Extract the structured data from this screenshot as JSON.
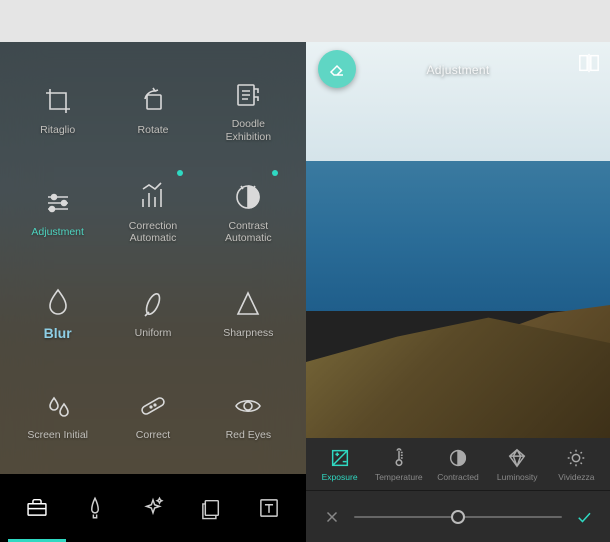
{
  "app": {
    "title": "Adjustment"
  },
  "colors": {
    "accent": "#2fd9c2"
  },
  "toolGrid": [
    {
      "key": "crop",
      "label": "Ritaglio"
    },
    {
      "key": "rotate",
      "label": "Rotate"
    },
    {
      "key": "doodle",
      "label": "Doodle Exhibition"
    },
    {
      "key": "adjustment",
      "label": "Adjustment",
      "active": true
    },
    {
      "key": "autocorrect",
      "label": "Correction Automatic",
      "badge": true
    },
    {
      "key": "autocontrast",
      "label": "Contrast Automatic",
      "badge": true
    },
    {
      "key": "blur",
      "label": "Blur",
      "highlight": true
    },
    {
      "key": "uniform",
      "label": "Uniform"
    },
    {
      "key": "sharpness",
      "label": "Sharpness"
    },
    {
      "key": "screen",
      "label": "Screen Initial"
    },
    {
      "key": "correct",
      "label": "Correct"
    },
    {
      "key": "redeyes",
      "label": "Red Eyes"
    }
  ],
  "bottomNav": [
    {
      "key": "toolbox",
      "active": true
    },
    {
      "key": "brush"
    },
    {
      "key": "magic"
    },
    {
      "key": "layers"
    },
    {
      "key": "text"
    }
  ],
  "adjustStrip": [
    {
      "key": "exposure",
      "label": "Exposure",
      "active": true
    },
    {
      "key": "temperature",
      "label": "Temperature"
    },
    {
      "key": "contrast",
      "label": "Contracted"
    },
    {
      "key": "luminosity",
      "label": "Luminosity"
    },
    {
      "key": "vividness",
      "label": "Vividezza"
    }
  ],
  "slider": {
    "value": 50,
    "min": 0,
    "max": 100
  }
}
